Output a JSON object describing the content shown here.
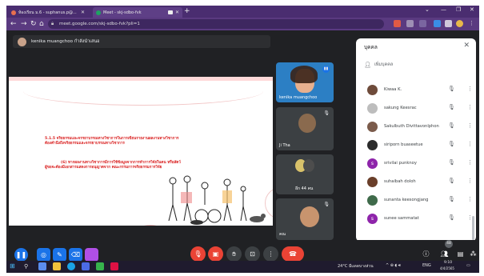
{
  "browser": {
    "tabs": [
      {
        "title": "ห้องเรียน ม.6 - suphanus.p@...",
        "favicon_color": "#e8704f",
        "active": false
      },
      {
        "title": "Meet - skj-sdbo-fvk",
        "favicon_color": "#1ea362",
        "active": true
      }
    ],
    "new_tab_symbol": "+",
    "url": "meet.google.com/skj-sdbo-fvk?pli=1"
  },
  "presenter_bar": {
    "label": "kenika muangchoo กำลังนำเสนอ"
  },
  "slide": {
    "line1": "5.1.5 จริยธรรมและจรรยาบรรณทางวิชาการในการเขียนรายงานผลงานทางวิชาการ",
    "line2": "ต้องคำนึงถึงจริยธรรมและจรรยาบรรณทางวิชาการ",
    "line3": "(6) หากผลงานทางวิชาการมีการใช้ข้อมูลจากการทำการวิจัยในคน หรือสัตว์",
    "line4": "ผู้ขอจะต้องมีเอกสารแสดงการอนุญาตจาก คณะกรรมการจริยธรรมการวิจัย"
  },
  "tiles": [
    {
      "name": "kenika muangchoo"
    },
    {
      "name": "Ji Tha"
    },
    {
      "name": "อีก 44 คน"
    },
    {
      "name": "คณ"
    }
  ],
  "people_panel": {
    "title": "บุคคล",
    "add_people": "เพิ่มบุคคล",
    "participants": [
      {
        "name": "Kiwaa K.",
        "avatar_color": "#6e4b3a",
        "initial": ""
      },
      {
        "name": "sakung Keesrac",
        "avatar_color": "#bdbdbd",
        "initial": ""
      },
      {
        "name": "Sakulbuth Divittavonlphon",
        "avatar_color": "#7b5b4b",
        "initial": ""
      },
      {
        "name": "siriporn buaseetue",
        "avatar_color": "#2b2b2b",
        "initial": ""
      },
      {
        "name": "srivilai punknoy",
        "avatar_color": "#8e24aa",
        "initial": "s"
      },
      {
        "name": "suhaibah doloh",
        "avatar_color": "#6a3f2a",
        "initial": ""
      },
      {
        "name": "sunanta keesongjang",
        "avatar_color": "#3f6a4a",
        "initial": ""
      },
      {
        "name": "sunee sammatat",
        "avatar_color": "#8e24aa",
        "initial": "s"
      }
    ]
  },
  "controls": {
    "participants_count": "48",
    "colors": {
      "end_call": "#ea4335",
      "muted": "#ea4335",
      "accent": "#1a73e8",
      "pen_purple": "#b04fe6"
    }
  },
  "taskbar": {
    "weather": "24°C มีแดดบางส่วน",
    "lang": "ENG",
    "time": "9:10",
    "date": "4/4/2565"
  }
}
